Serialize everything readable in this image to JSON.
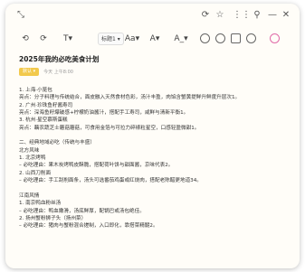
{
  "window": {
    "title_controls": [
      "—",
      "✕"
    ]
  },
  "toolbar": {
    "heading_label": "标题1",
    "font_label": "Aa",
    "color_label": "A"
  },
  "note": {
    "title": "2025年我的必吃美食计划",
    "tag": "默认",
    "timestamp": "今天 上午8:00",
    "lines": [
      "1. 上海·小笼包",
      "亮点：分子料理与传统结合，面皮融入天然食材色彩，汤汁丰盈，肉馅含蟹黄提鲜升鲜度升层次1。",
      "2. 广州·珍珠鱼籽酱寿司",
      "亮点：深海鱼籽爆破感+柠檬奶油酱汁，搭配手工寿司，咸鲜与清新平衡1。",
      "3. 杭州·星空慕斯蛋糕",
      "亮点：藕农蔬芝士蘑菇蘑菇，可食用金箔与可拉力碎裱粒星空，口感轻盈微甜1。",
      "",
      "二、经典地域必吃（传统与丰盛）",
      "北方风味",
      "1. 北京烤鸭",
      "– 必吃理由：果木炭烤鸭皮酥脆，搭配荷叶饼与甜面酱，京味代表2。",
      "2. 山西刀削面",
      "– 必吃理由：手工刮削面条，汤头可选番茄鸡蛋或红烧肉，搭配老陈醋更地道34。",
      "",
      "江南风情",
      "1. 南京鸭血粉丝汤",
      "– 必吃理由：鸭血嫩滑，汤底鲜厚，配锅巴或汤包绝佳。",
      "2. 扬州蟹粉狮子头（扬州菜）",
      "– 必吃理由：猪肉与蟹粉混合搓制，入口即化，靠搭菜精髓2。"
    ]
  }
}
